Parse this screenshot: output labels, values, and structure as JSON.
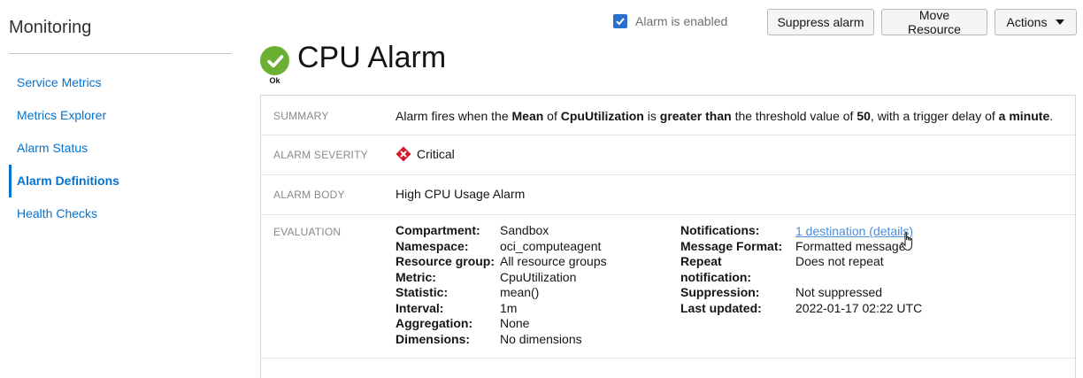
{
  "sidebar": {
    "title": "Monitoring",
    "items": [
      {
        "label": "Service Metrics",
        "active": false
      },
      {
        "label": "Metrics Explorer",
        "active": false
      },
      {
        "label": "Alarm Status",
        "active": false
      },
      {
        "label": "Alarm Definitions",
        "active": true
      },
      {
        "label": "Health Checks",
        "active": false
      }
    ]
  },
  "toolbar": {
    "alarm_enabled_label": "Alarm is enabled",
    "alarm_enabled": true,
    "suppress_label": "Suppress alarm",
    "move_label": "Move Resource",
    "actions_label": "Actions"
  },
  "header": {
    "title": "CPU Alarm",
    "status": "Ok",
    "status_color": "#6cb033"
  },
  "summary": {
    "label": "SUMMARY",
    "parts": [
      {
        "text": "Alarm fires when the ",
        "bold": false
      },
      {
        "text": "Mean",
        "bold": true
      },
      {
        "text": " of ",
        "bold": false
      },
      {
        "text": "CpuUtilization",
        "bold": true
      },
      {
        "text": " is ",
        "bold": false
      },
      {
        "text": "greater than",
        "bold": true
      },
      {
        "text": " the threshold value of ",
        "bold": false
      },
      {
        "text": "50",
        "bold": true
      },
      {
        "text": ", with a trigger delay of ",
        "bold": false
      },
      {
        "text": "a minute",
        "bold": true
      },
      {
        "text": ".",
        "bold": false
      }
    ]
  },
  "severity": {
    "label": "ALARM SEVERITY",
    "value": "Critical",
    "color": "#d11a2a"
  },
  "body": {
    "label": "ALARM BODY",
    "value": "High CPU Usage Alarm"
  },
  "evaluation": {
    "label": "EVALUATION",
    "left": [
      {
        "key": "Compartment:",
        "value": "Sandbox"
      },
      {
        "key": "Namespace:",
        "value": "oci_computeagent"
      },
      {
        "key": "Resource group:",
        "value": "All resource groups"
      },
      {
        "key": "Metric:",
        "value": "CpuUtilization"
      },
      {
        "key": "Statistic:",
        "value": "mean()"
      },
      {
        "key": "Interval:",
        "value": "1m"
      },
      {
        "key": "Aggregation:",
        "value": "None"
      },
      {
        "key": "Dimensions:",
        "value": "No dimensions"
      }
    ],
    "right": {
      "notifications_key": "Notifications:",
      "notifications_value": "1 destination (details)",
      "format_key": "Message Format:",
      "format_value": "Formatted message",
      "repeat_key_1": "Repeat",
      "repeat_key_2": "notification:",
      "repeat_value": "Does not repeat",
      "suppression_key": "Suppression:",
      "suppression_value": "Not suppressed",
      "updated_key": "Last updated:",
      "updated_value": "2022-01-17 02:22 UTC"
    }
  }
}
